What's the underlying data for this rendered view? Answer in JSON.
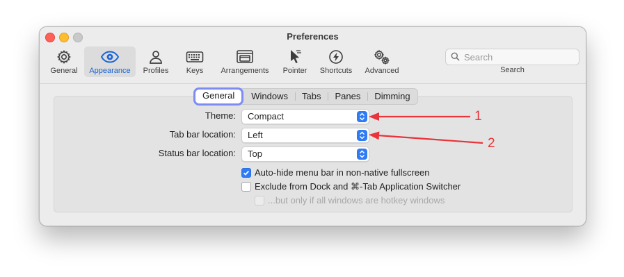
{
  "window": {
    "title": "Preferences"
  },
  "toolbar": {
    "items": [
      {
        "label": "General",
        "icon": "gear-icon",
        "selected": false
      },
      {
        "label": "Appearance",
        "icon": "eye-icon",
        "selected": true
      },
      {
        "label": "Profiles",
        "icon": "person-icon",
        "selected": false
      },
      {
        "label": "Keys",
        "icon": "keyboard-icon",
        "selected": false
      },
      {
        "label": "Arrangements",
        "icon": "windows-icon",
        "selected": false
      },
      {
        "label": "Pointer",
        "icon": "pointer-icon",
        "selected": false
      },
      {
        "label": "Shortcuts",
        "icon": "bolt-icon",
        "selected": false
      },
      {
        "label": "Advanced",
        "icon": "gears-icon",
        "selected": false
      }
    ],
    "search": {
      "placeholder": "Search",
      "label": "Search"
    }
  },
  "tabs": [
    {
      "label": "General",
      "active": true
    },
    {
      "label": "Windows",
      "active": false
    },
    {
      "label": "Tabs",
      "active": false
    },
    {
      "label": "Panes",
      "active": false
    },
    {
      "label": "Dimming",
      "active": false
    }
  ],
  "settings": {
    "theme": {
      "label": "Theme:",
      "value": "Compact"
    },
    "tab_bar": {
      "label": "Tab bar location:",
      "value": "Left"
    },
    "status_bar": {
      "label": "Status bar location:",
      "value": "Top"
    },
    "checks": [
      {
        "label": "Auto-hide menu bar in non-native fullscreen",
        "checked": true,
        "enabled": true
      },
      {
        "label": "Exclude from Dock and ⌘-Tab Application Switcher",
        "checked": false,
        "enabled": true
      },
      {
        "label": "...but only if all windows are hotkey windows",
        "checked": false,
        "enabled": false
      }
    ]
  },
  "annotations": [
    {
      "number": "1",
      "color": "#e8343a"
    },
    {
      "number": "2",
      "color": "#e8343a"
    }
  ],
  "colors": {
    "accent": "#2f7bf6",
    "selected_tab_ring": "#7c8cf2",
    "annotation": "#e8343a"
  }
}
